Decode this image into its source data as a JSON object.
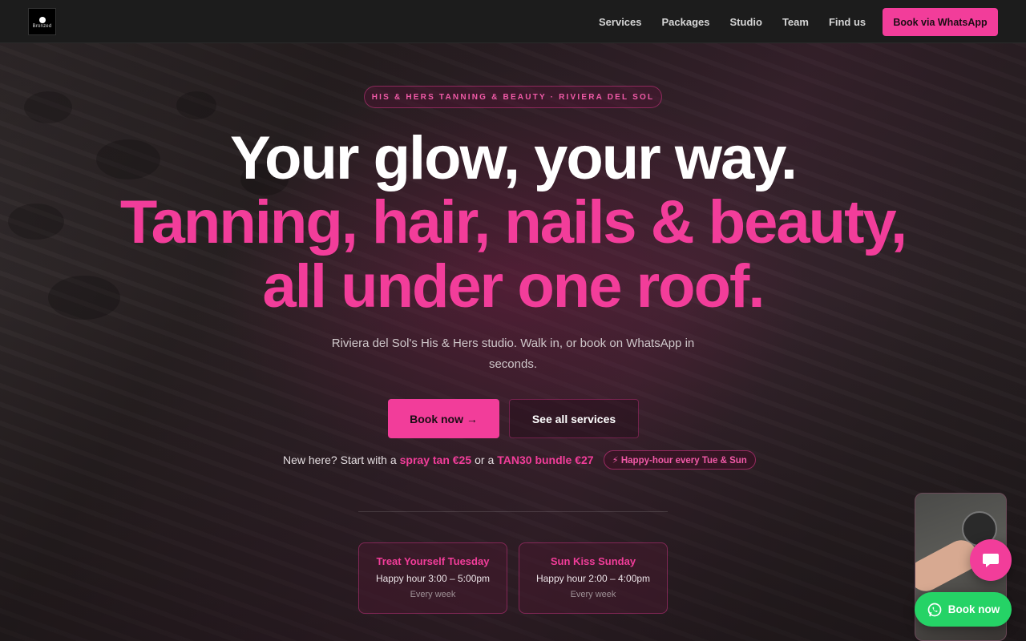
{
  "brand": {
    "logo_text": "Bronzed",
    "accent": "#f23d9a",
    "whatsapp_green": "#25d366"
  },
  "nav": {
    "links": [
      "Services",
      "Packages",
      "Studio",
      "Team",
      "Find us"
    ],
    "cta": "Book via WhatsApp"
  },
  "hero": {
    "eyebrow": "HIS & HERS TANNING & BEAUTY · RIVIERA DEL SOL",
    "headline_1": "Your glow, your way.",
    "headline_2": "Tanning, hair, nails & beauty, all under one roof.",
    "subtitle": "Riviera del Sol's His & Hers studio. Walk in, or book on WhatsApp in seconds.",
    "primary_button": "Book now →",
    "secondary_button": "See all services",
    "offer": {
      "prefix": "New here? Start with a",
      "link_1": "spray tan €25",
      "middle": "or a",
      "link_2": "TAN30 bundle €27",
      "badge": "⚡ Happy-hour every Tue & Sun"
    },
    "cards": [
      {
        "title": "Treat Yourself Tuesday",
        "hours": "Happy hour 3:00 – 5:00pm",
        "frequency": "Every week"
      },
      {
        "title": "Sun Kiss Sunday",
        "hours": "Happy hour 2:00 – 4:00pm",
        "frequency": "Every week"
      }
    ]
  },
  "widget": {
    "chat_icon": "chat-bubble-icon",
    "whatsapp_icon": "whatsapp-icon",
    "whatsapp_label": "Book now"
  }
}
